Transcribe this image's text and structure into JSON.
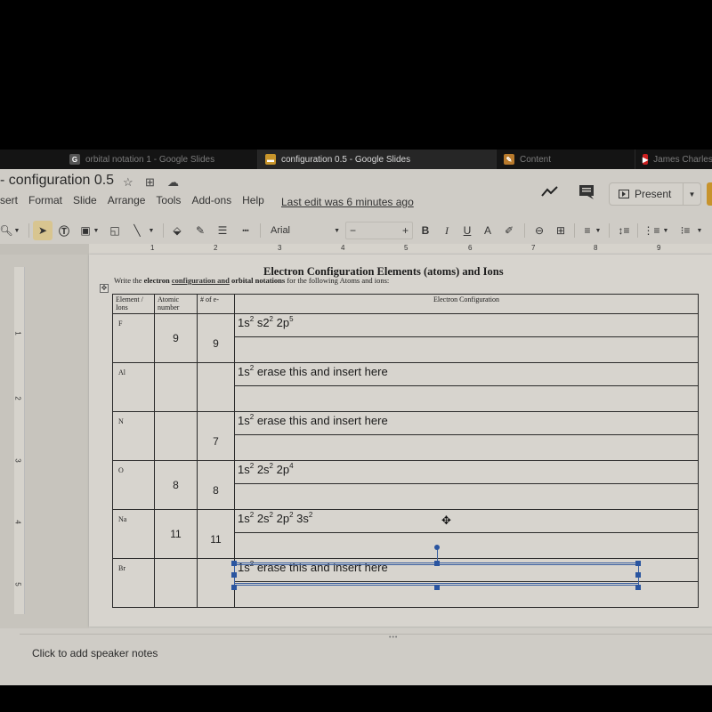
{
  "browser": {
    "tabs": [
      {
        "title": "orbital notation 1 - Google Slides",
        "favicon": "G",
        "favicon_color": "#666666",
        "active": false
      },
      {
        "title": "configuration 0.5 - Google Slides",
        "favicon": "slides",
        "favicon_color": "#c8952b",
        "active": true
      },
      {
        "title": "Content",
        "favicon": "pencil",
        "favicon_color": "#b87a2c",
        "active": false
      },
      {
        "title": "James Charles",
        "favicon": "youtube",
        "favicon_color": "#cc2020",
        "active": false
      }
    ]
  },
  "header": {
    "doc_title": "- configuration 0.5",
    "icons": [
      "star-icon",
      "move-to-folder-icon",
      "cloud-saved-icon"
    ],
    "menu": [
      "sert",
      "Format",
      "Slide",
      "Arrange",
      "Tools",
      "Add-ons",
      "Help"
    ],
    "last_edit": "Last edit was 6 minutes ago",
    "present_label": "Present"
  },
  "toolbar": {
    "font": "Arial",
    "font_size": "",
    "minus": "−",
    "plus": "+",
    "bold": "B",
    "italic": "I",
    "underline": "U",
    "text_color": "A"
  },
  "ruler": {
    "horizontal": [
      "1",
      "2",
      "3",
      "4",
      "5",
      "6",
      "7",
      "8",
      "9"
    ],
    "vertical": [
      "1",
      "2",
      "3",
      "4",
      "5"
    ]
  },
  "slide": {
    "title": "Electron Configuration Elements (atoms) and Ions",
    "subtitle_pre": "Write the ",
    "subtitle_bold1": "electron ",
    "subtitle_link": "configuration  and",
    "subtitle_bold2": " orbital notations",
    "subtitle_post": " for the following Atoms and ions:",
    "table": {
      "headers": [
        "Element / Ions",
        "Atomic number",
        "# of e-",
        "Electron Configuration"
      ],
      "rows": [
        {
          "element": "F",
          "atomic_number": "9",
          "electrons": "9",
          "config": "1s² s2² 2p⁵"
        },
        {
          "element": "Al",
          "atomic_number": "",
          "electrons": "",
          "config": "1s² erase this and insert here"
        },
        {
          "element": "N",
          "atomic_number": "",
          "electrons": "7",
          "config": "1s² erase this and insert here"
        },
        {
          "element": "O",
          "atomic_number": "8",
          "electrons": "8",
          "config": "1s² 2s² 2p⁴"
        },
        {
          "element": "Na",
          "atomic_number": "11",
          "electrons": "11",
          "config": "1s² 2s² 2p² 3s²"
        },
        {
          "element": "Br",
          "atomic_number": "",
          "electrons": "",
          "config": "1s² erase this and insert here"
        }
      ]
    }
  },
  "notes": {
    "placeholder": "Click to add speaker notes"
  },
  "colors": {
    "selection": "#2a55a0",
    "share_button": "#c7932c",
    "select_tool_active": "#d8c590"
  }
}
